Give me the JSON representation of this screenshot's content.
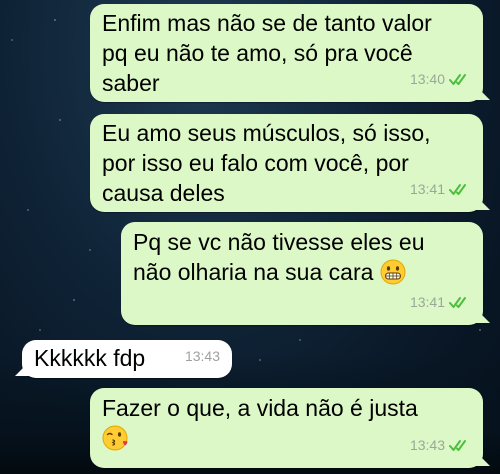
{
  "colors": {
    "outgoing_bubble": "#dcf8c6",
    "incoming_bubble": "#ffffff",
    "read_check": "#4cbf3e",
    "timestamp": "#9aa89a"
  },
  "messages": [
    {
      "direction": "outgoing",
      "text": "Enfim mas não se de tanto valor\npq eu não te amo, só pra você\nsaber",
      "time": "13:40",
      "status_icon": "double-check-icon"
    },
    {
      "direction": "outgoing",
      "text": "Eu amo seus músculos, só isso,\npor isso eu falo com você, por\ncausa deles",
      "time": "13:41",
      "status_icon": "double-check-icon"
    },
    {
      "direction": "outgoing",
      "text": "Pq se vc não tivesse eles eu\nnão olharia na sua cara",
      "emoji": "grimacing-face-emoji",
      "time": "13:41",
      "status_icon": "double-check-icon"
    },
    {
      "direction": "incoming",
      "text": "Kkkkkk fdp",
      "time": "13:43"
    },
    {
      "direction": "outgoing",
      "text": "Fazer o que, a vida não é justa",
      "emoji": "face-blowing-kiss-emoji",
      "time": "13:43",
      "status_icon": "double-check-icon"
    }
  ]
}
